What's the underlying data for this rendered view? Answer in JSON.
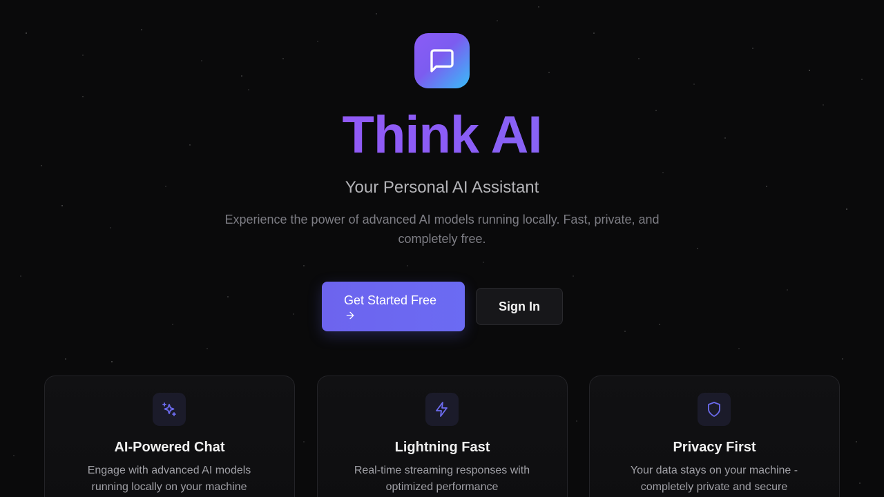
{
  "hero": {
    "title": "Think AI",
    "subtitle": "Your Personal AI Assistant",
    "description": "Experience the power of advanced AI models running locally. Fast, private, and completely free.",
    "logo_icon": "message-square-icon"
  },
  "actions": {
    "primary_label": "Get Started Free",
    "primary_icon": "arrow-right-icon",
    "secondary_label": "Sign In"
  },
  "features": [
    {
      "icon": "sparkles-icon",
      "title": "AI-Powered Chat",
      "text": "Engage with advanced AI models running locally on your machine"
    },
    {
      "icon": "zap-icon",
      "title": "Lightning Fast",
      "text": "Real-time streaming responses with optimized performance"
    },
    {
      "icon": "shield-icon",
      "title": "Privacy First",
      "text": "Your data stays on your machine - completely private and secure"
    }
  ],
  "colors": {
    "background": "#0a0a0b",
    "accent": "#6366f1",
    "title_gradient_start": "#a855f7",
    "title_gradient_end": "#7c7cf0",
    "logo_gradient_start": "#8b5cf6",
    "logo_gradient_end": "#38bdf8"
  }
}
